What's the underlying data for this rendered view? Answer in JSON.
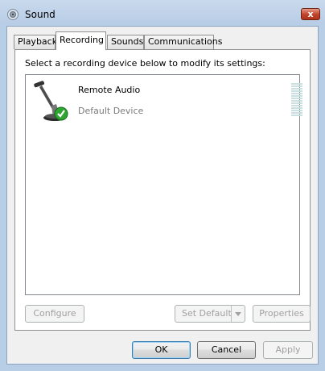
{
  "window": {
    "title": "Sound",
    "close_label": "x",
    "tabs": [
      "Playback",
      "Recording",
      "Sounds",
      "Communications"
    ],
    "active_tab": "Recording"
  },
  "recording": {
    "instruction": "Select a recording device below to modify its settings:",
    "devices": [
      {
        "name": "Remote Audio",
        "status": "Default Device",
        "icon": "microphone-default-icon"
      }
    ]
  },
  "buttons": {
    "configure": "Configure",
    "set_default": "Set Default",
    "properties": "Properties",
    "ok": "OK",
    "cancel": "Cancel",
    "apply": "Apply"
  }
}
